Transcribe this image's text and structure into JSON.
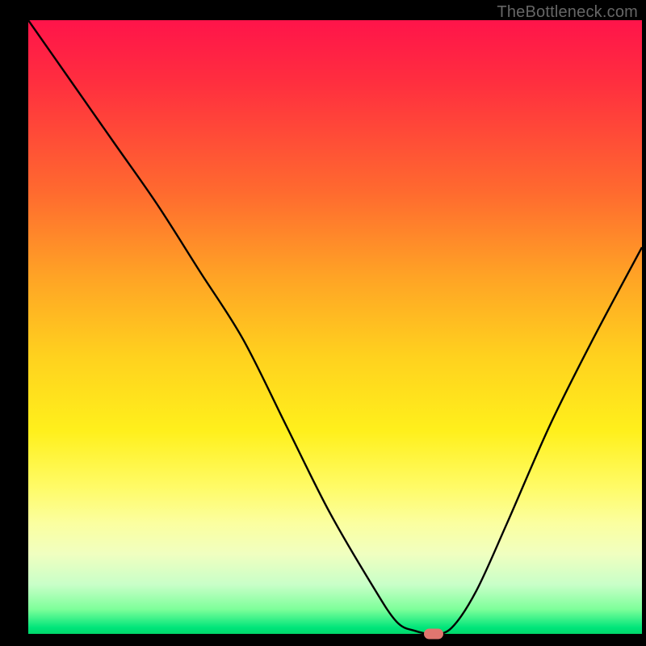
{
  "watermark": "TheBottleneck.com",
  "colors": {
    "page_bg": "#000000",
    "marker": "#e0766f",
    "curve": "#000000"
  },
  "chart_data": {
    "type": "line",
    "title": "",
    "xlabel": "",
    "ylabel": "",
    "xlim": [
      0,
      100
    ],
    "ylim": [
      0,
      100
    ],
    "grid": false,
    "legend": false,
    "series": [
      {
        "name": "bottleneck-curve",
        "x": [
          0,
          7,
          14,
          21,
          28,
          35,
          42,
          49,
          56,
          60,
          63,
          66,
          69,
          73,
          78,
          85,
          92,
          100
        ],
        "y": [
          100,
          90,
          80,
          70,
          59,
          48,
          34,
          20,
          8,
          2,
          0.5,
          0,
          1,
          7,
          18,
          34,
          48,
          63
        ]
      }
    ],
    "marker": {
      "x": 66,
      "y": 0
    },
    "gradient_stops": [
      {
        "pos": 0,
        "color": "#ff144a"
      },
      {
        "pos": 10,
        "color": "#ff2e3f"
      },
      {
        "pos": 28,
        "color": "#ff6a2f"
      },
      {
        "pos": 42,
        "color": "#ffa425"
      },
      {
        "pos": 55,
        "color": "#ffd21e"
      },
      {
        "pos": 67,
        "color": "#fff01c"
      },
      {
        "pos": 76,
        "color": "#fffb66"
      },
      {
        "pos": 82,
        "color": "#fbffa0"
      },
      {
        "pos": 87,
        "color": "#f0ffc0"
      },
      {
        "pos": 92,
        "color": "#c8ffc8"
      },
      {
        "pos": 96,
        "color": "#7dff9a"
      },
      {
        "pos": 99,
        "color": "#00e57a"
      },
      {
        "pos": 100,
        "color": "#00d76a"
      }
    ]
  }
}
